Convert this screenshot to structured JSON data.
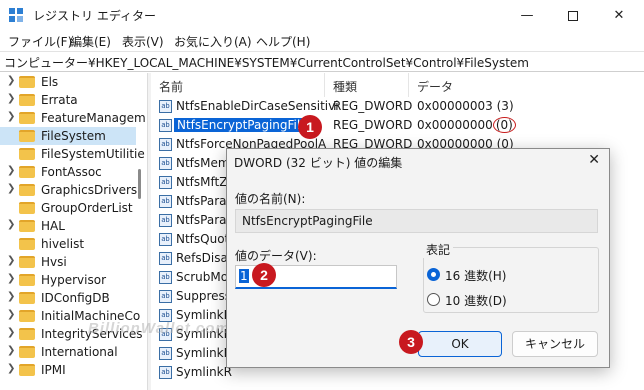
{
  "window": {
    "title": "レジストリ エディター",
    "controls": {
      "minimize": "—",
      "maximize": "",
      "close": "✕"
    }
  },
  "menu": [
    "ファイル(F)",
    "編集(E)",
    "表示(V)",
    "お気に入り(A)",
    "ヘルプ(H)"
  ],
  "address": "コンピューター¥HKEY_LOCAL_MACHINE¥SYSTEM¥CurrentControlSet¥Control¥FileSystem",
  "tree": {
    "items": [
      {
        "label": "Els",
        "selected": false
      },
      {
        "label": "Errata",
        "selected": false
      },
      {
        "label": "FeatureManagem",
        "selected": false
      },
      {
        "label": "FileSystem",
        "selected": true
      },
      {
        "label": "FileSystemUtilitie",
        "selected": false
      },
      {
        "label": "FontAssoc",
        "selected": false
      },
      {
        "label": "GraphicsDrivers",
        "selected": false
      },
      {
        "label": "GroupOrderList",
        "selected": false
      },
      {
        "label": "HAL",
        "selected": false
      },
      {
        "label": "hivelist",
        "selected": false
      },
      {
        "label": "Hvsi",
        "selected": false
      },
      {
        "label": "Hypervisor",
        "selected": false
      },
      {
        "label": "IDConfigDB",
        "selected": false
      },
      {
        "label": "InitialMachineCo",
        "selected": false
      },
      {
        "label": "IntegrityServices",
        "selected": false
      },
      {
        "label": "International",
        "selected": false
      },
      {
        "label": "IPMI",
        "selected": false
      }
    ]
  },
  "list": {
    "columns": {
      "name": "名前",
      "type": "種類",
      "data": "データ"
    },
    "icon_text": "ab",
    "rows": [
      {
        "name": "NtfsEnableDirCaseSensitivi",
        "type": "REG_DWORD",
        "data": "0x00000003 (3)",
        "selected": false
      },
      {
        "name": "NtfsEncryptPagingFile",
        "type": "REG_DWORD",
        "data": "0x00000000",
        "data_suffix": "(0)",
        "selected": true
      },
      {
        "name": "NtfsForceNonPagedPoolA",
        "type": "REG_DWORD",
        "data": "0x00000000 (0)",
        "selected": false
      },
      {
        "name": "NtfsMemo",
        "type": "",
        "data": "",
        "selected": false
      },
      {
        "name": "NtfsMftZo",
        "type": "",
        "data": "",
        "selected": false
      },
      {
        "name": "NtfsParall",
        "type": "",
        "data": "",
        "selected": false
      },
      {
        "name": "NtfsParall",
        "type": "",
        "data": "",
        "selected": false
      },
      {
        "name": "NtfsQuota",
        "type": "",
        "data": "",
        "selected": false
      },
      {
        "name": "RefsDisab",
        "type": "",
        "data": "",
        "selected": false
      },
      {
        "name": "ScrubMo",
        "type": "",
        "data": "",
        "selected": false
      },
      {
        "name": "Suppress",
        "type": "",
        "data": "",
        "selected": false
      },
      {
        "name": "SymlinkL",
        "type": "",
        "data": "",
        "selected": false
      },
      {
        "name": "SymlinkL",
        "type": "",
        "data": "",
        "selected": false
      },
      {
        "name": "SymlinkR",
        "type": "",
        "data": "",
        "selected": false
      },
      {
        "name": "SymlinkR",
        "type": "",
        "data": "",
        "selected": false
      }
    ]
  },
  "dialog": {
    "title": "DWORD (32 ビット) 値の編集",
    "close": "✕",
    "name_label": "値の名前(N):",
    "name_value": "NtfsEncryptPagingFile",
    "data_label": "値のデータ(V):",
    "data_value": "1",
    "radix_label": "表記",
    "radix_options": [
      {
        "label": "16 進数(H)",
        "checked": true
      },
      {
        "label": "10 進数(D)",
        "checked": false
      }
    ],
    "ok": "OK",
    "cancel": "キャンセル"
  },
  "steps": [
    "1",
    "2",
    "3"
  ],
  "watermark": "BillionWallet.com",
  "colors": {
    "selection": "#0a64d6",
    "tree_selection": "#cce4f7",
    "badge": "#c8191f"
  }
}
